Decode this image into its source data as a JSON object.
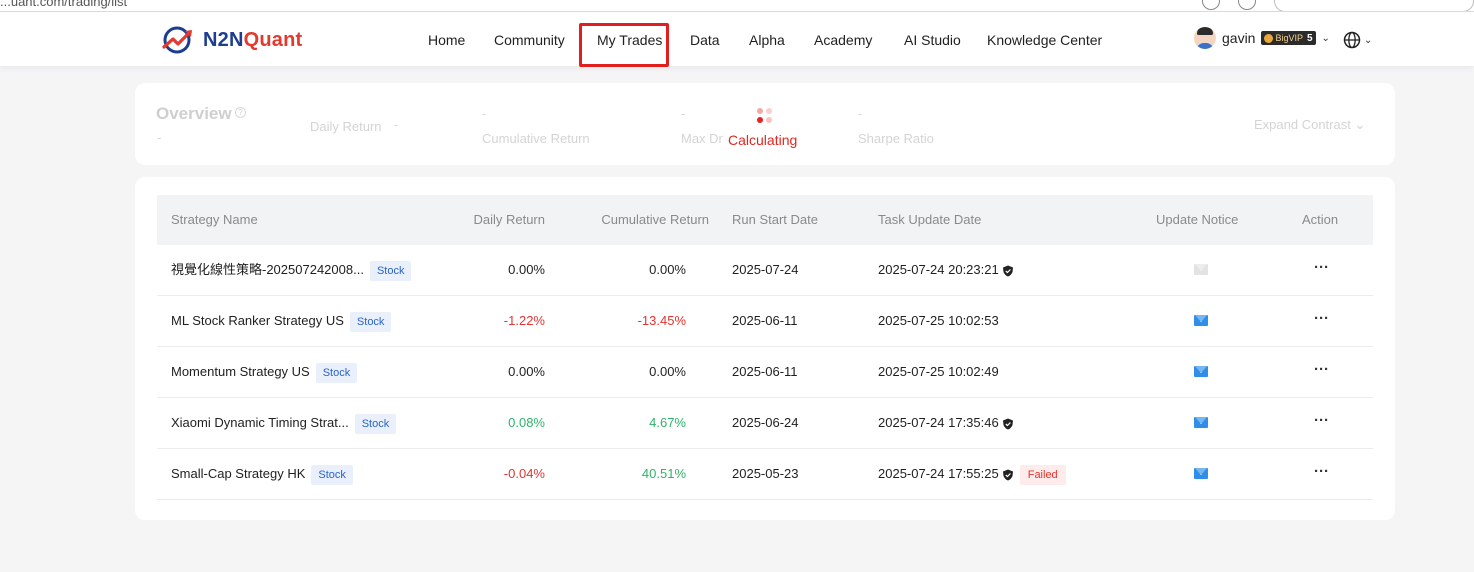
{
  "browser": {
    "url": "...uant.com/trading/list"
  },
  "header": {
    "logo_part1": "N2N",
    "logo_part2": "Quant",
    "nav": [
      "Home",
      "Community",
      "My Trades",
      "Data",
      "Alpha",
      "Academy",
      "AI Studio",
      "Knowledge Center"
    ],
    "active_nav": "My Trades",
    "user": {
      "name": "gavin",
      "vip_label": "BigVIP",
      "vip_level": "5"
    }
  },
  "overview": {
    "title": "Overview",
    "daily_return_label": "Daily Return",
    "daily_return_value": "-",
    "cumulative_return_label": "Cumulative Return",
    "cumulative_return_value": "-",
    "max_drawdown_label": "Max Dr",
    "max_drawdown_value": "-",
    "sharpe_label": "Sharpe Ratio",
    "sharpe_value": "-",
    "left_value": "-",
    "expand_label": "Expand Contrast",
    "status": "Calculating"
  },
  "table": {
    "headers": {
      "name": "Strategy Name",
      "daily": "Daily Return",
      "cumulative": "Cumulative Return",
      "start": "Run Start Date",
      "update": "Task Update Date",
      "notice": "Update Notice",
      "action": "Action"
    },
    "rows": [
      {
        "name": "視覺化線性策略-202507242008...",
        "tag": "Stock",
        "daily": "0.00%",
        "cumulative": "0.00%",
        "start": "2025-07-24",
        "update": "2025-07-24 20:23:21",
        "status": "",
        "notice": "off"
      },
      {
        "name": "ML Stock Ranker Strategy US",
        "tag": "Stock",
        "daily": "-1.22%",
        "cumulative": "-13.45%",
        "start": "2025-06-11",
        "update": "2025-07-25 10:02:53",
        "status": "",
        "notice": "on"
      },
      {
        "name": "Momentum Strategy US",
        "tag": "Stock",
        "daily": "0.00%",
        "cumulative": "0.00%",
        "start": "2025-06-11",
        "update": "2025-07-25 10:02:49",
        "status": "",
        "notice": "on"
      },
      {
        "name": "Xiaomi Dynamic Timing Strat...",
        "tag": "Stock",
        "daily": "0.08%",
        "cumulative": "4.67%",
        "start": "2025-06-24",
        "update": "2025-07-24 17:35:46",
        "status": "",
        "notice": "on"
      },
      {
        "name": "Small-Cap Strategy HK",
        "tag": "Stock",
        "daily": "-0.04%",
        "cumulative": "40.51%",
        "start": "2025-05-23",
        "update": "2025-07-24 17:55:25",
        "status": "Failed",
        "notice": "on"
      }
    ],
    "action_glyph": "···"
  },
  "colors": {
    "brand_blue": "#1d3d8f",
    "brand_red": "#e23a2e",
    "negative": "#e3342f",
    "positive": "#2fb36a",
    "mail": "#2f8fe8"
  }
}
